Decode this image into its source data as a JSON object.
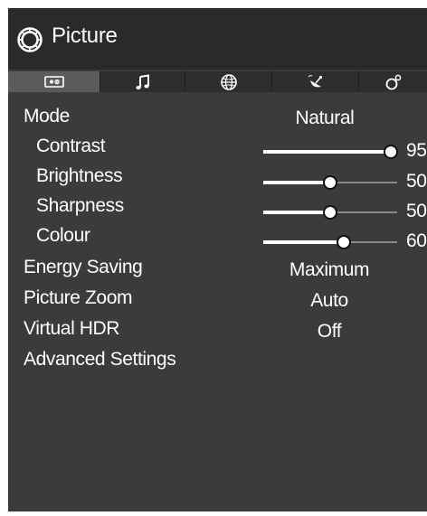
{
  "header": {
    "title": "Picture",
    "icon": "settings-ring-icon"
  },
  "tabs": [
    {
      "name": "picture",
      "icon": "picture-settings-icon",
      "active": true
    },
    {
      "name": "sound",
      "icon": "music-note-icon",
      "active": false
    },
    {
      "name": "network",
      "icon": "globe-icon",
      "active": false
    },
    {
      "name": "installation",
      "icon": "satellite-dish-icon",
      "active": false
    },
    {
      "name": "system",
      "icon": "system-settings-icon",
      "active": false
    }
  ],
  "menu": {
    "mode": {
      "label": "Mode",
      "value": "Natural"
    },
    "contrast": {
      "label": "Contrast",
      "value": "95",
      "level": 95
    },
    "brightness": {
      "label": "Brightness",
      "value": "50",
      "level": 50
    },
    "sharpness": {
      "label": "Sharpness",
      "value": "50",
      "level": 50
    },
    "colour": {
      "label": "Colour",
      "value": "60",
      "level": 60
    },
    "energy_saving": {
      "label": "Energy Saving",
      "value": "Maximum"
    },
    "picture_zoom": {
      "label": "Picture Zoom",
      "value": "Auto"
    },
    "virtual_hdr": {
      "label": "Virtual HDR",
      "value": "Off"
    },
    "advanced_settings": {
      "label": "Advanced Settings"
    }
  },
  "colors": {
    "background": "#3b3b3b",
    "header": "#2a2a2a",
    "active_tab": "#5b5b5b",
    "text": "#ffffff"
  }
}
